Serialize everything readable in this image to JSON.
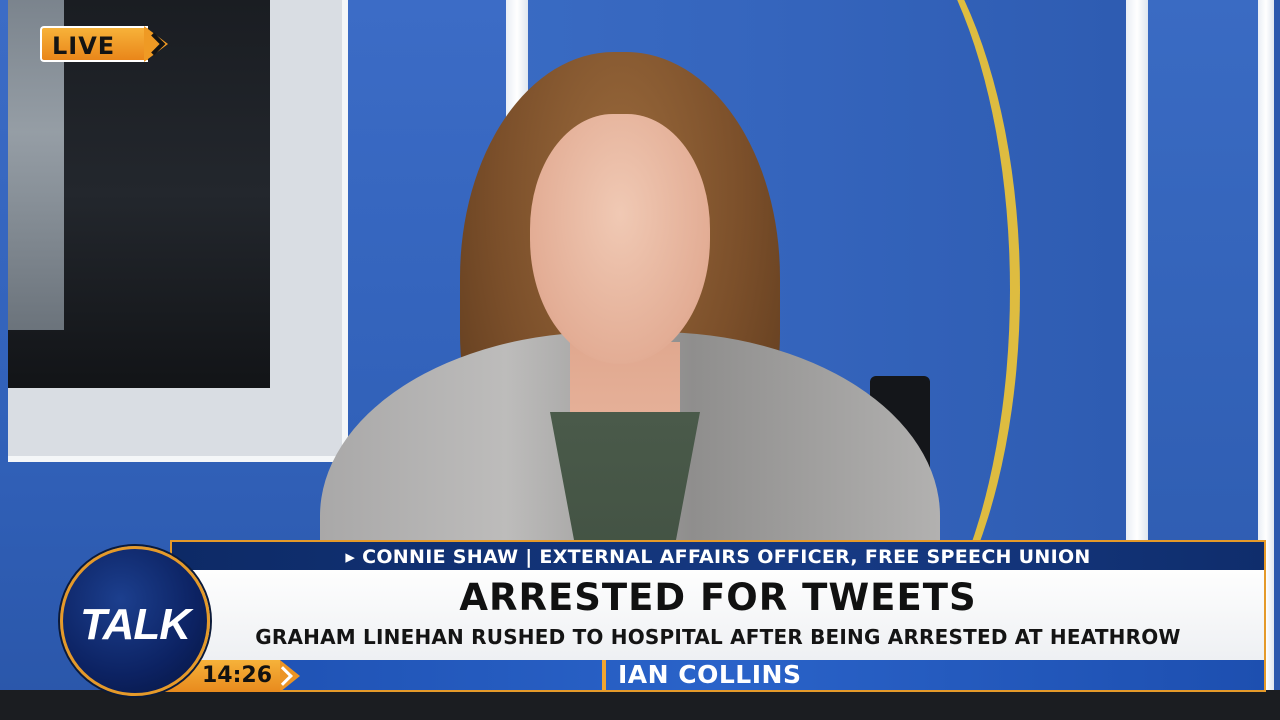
{
  "live_badge": {
    "label": "LIVE"
  },
  "lower_third": {
    "guest_line": "▸ CONNIE SHAW | EXTERNAL AFFAIRS OFFICER, FREE SPEECH UNION",
    "headline": "ARRESTED FOR TWEETS",
    "subheadline": "GRAHAM LINEHAN RUSHED TO HOSPITAL AFTER BEING ARRESTED AT HEATHROW",
    "clock": "14:26",
    "presenter": "IAN COLLINS"
  },
  "logo": {
    "text": "TALK"
  },
  "colors": {
    "accent_orange": "#e59a2a",
    "navy": "#0d2a66",
    "blue_bar": "#2a63c9",
    "studio_blue": "#3565bd"
  },
  "icons": {
    "live_arrow": "chevron-right-icon",
    "clock_arrow": "chevron-right-icon"
  }
}
